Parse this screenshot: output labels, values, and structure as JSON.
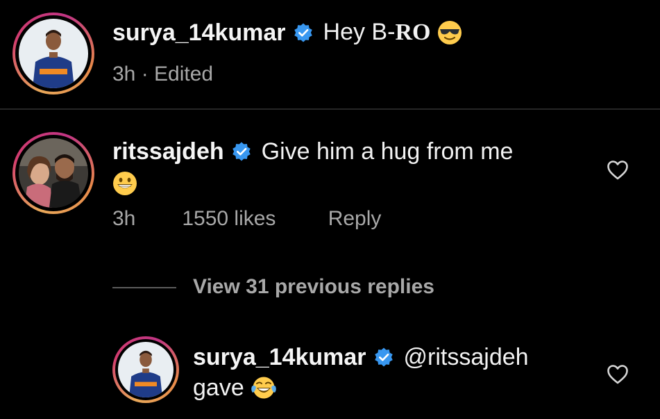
{
  "comments": [
    {
      "username": "surya_14kumar",
      "text": "Hey B-",
      "text_bold": "RO",
      "emoji": "sunglasses-emoji",
      "time": "3h",
      "edited": "· Edited"
    },
    {
      "username": "ritssajdeh",
      "text": "Give him a hug from me",
      "emoji": "grinning-emoji",
      "time": "3h",
      "likes": "1550 likes",
      "reply": "Reply"
    }
  ],
  "view_replies": "View 31 previous replies",
  "reply_comment": {
    "username": "surya_14kumar",
    "mention": "@ritssajdeh",
    "text": "gave",
    "emoji": "tears-of-joy-emoji"
  },
  "colors": {
    "background": "#000000",
    "verified": "#3897f0",
    "muted": "#a8a8a8",
    "emoji": "#ffcc4d"
  }
}
